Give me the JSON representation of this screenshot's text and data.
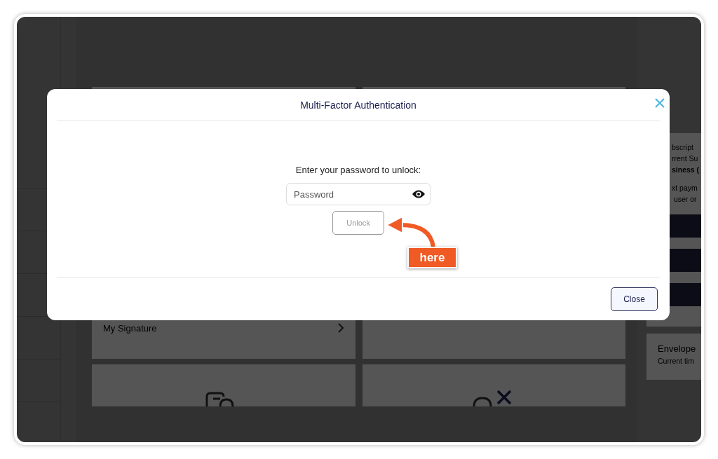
{
  "background": {
    "cards": [
      {
        "title": "My Signature"
      }
    ],
    "side_panel": {
      "lines": [
        "bscript",
        "rrent Su",
        "siness (",
        "xt paym",
        " user or"
      ],
      "section_title": "Envelope",
      "section_text": "Current tim"
    }
  },
  "modal": {
    "title": "Multi-Factor Authentication",
    "prompt": "Enter your password to unlock:",
    "password": {
      "placeholder": "Password"
    },
    "unlock": {
      "label": "Unlock",
      "disabled": true
    },
    "close": {
      "label": "Close"
    }
  },
  "annotation": {
    "text": "here"
  }
}
